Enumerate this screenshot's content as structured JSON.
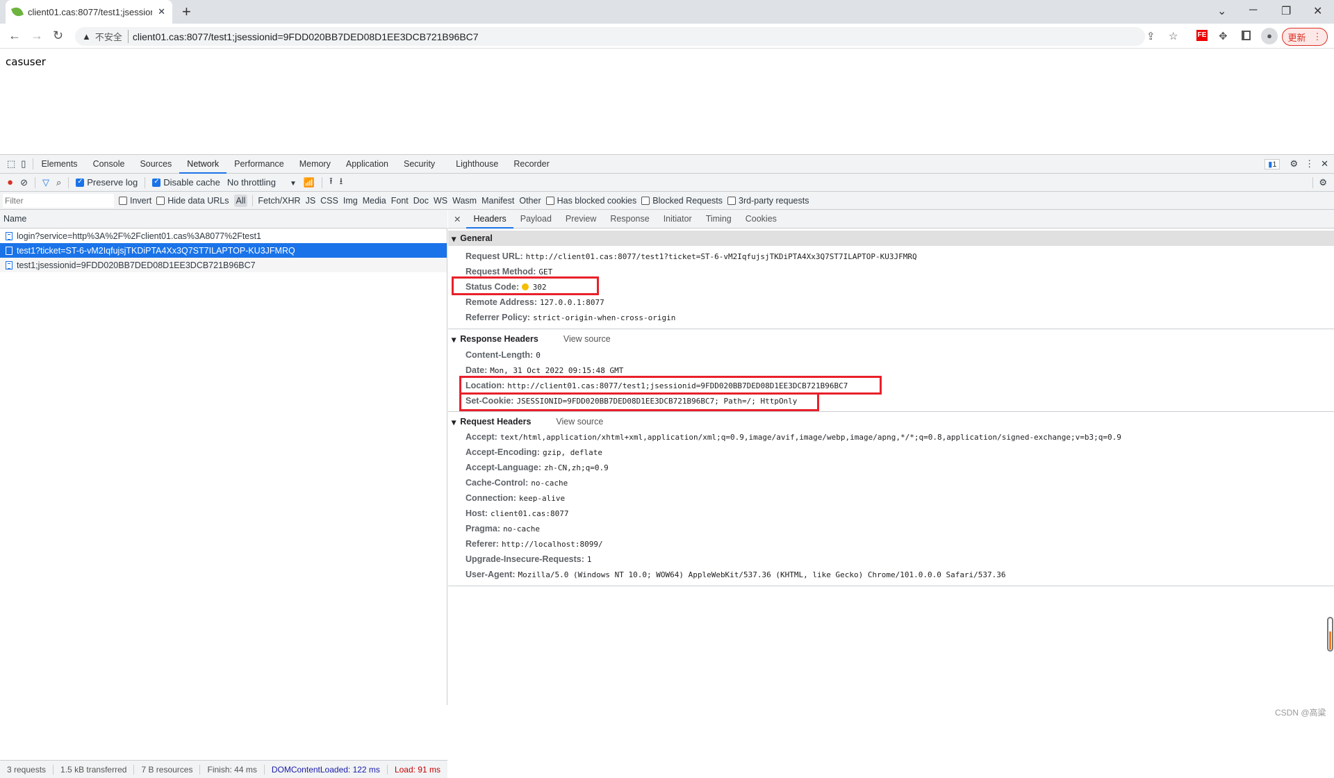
{
  "browser": {
    "tab_title": "client01.cas:8077/test1;jsession",
    "security_label": "不安全",
    "url": "client01.cas:8077/test1;jsessionid=9FDD020BB7DED08D1EE3DCB721B96BC7",
    "update_label": "更新",
    "extension_label": "FE"
  },
  "page": {
    "text": "casuser"
  },
  "devtools": {
    "tabs": [
      "Elements",
      "Console",
      "Sources",
      "Network",
      "Performance",
      "Memory",
      "Application",
      "Security",
      "Lighthouse",
      "Recorder"
    ],
    "active_tab": "Network",
    "issues_count": "1",
    "toolbar": {
      "preserve_log": "Preserve log",
      "disable_cache": "Disable cache",
      "throttling": "No throttling"
    },
    "filter": {
      "placeholder": "Filter",
      "invert": "Invert",
      "hide_data_urls": "Hide data URLs",
      "types": [
        "All",
        "Fetch/XHR",
        "JS",
        "CSS",
        "Img",
        "Media",
        "Font",
        "Doc",
        "WS",
        "Wasm",
        "Manifest",
        "Other"
      ],
      "has_blocked_cookies": "Has blocked cookies",
      "blocked_requests": "Blocked Requests",
      "third_party": "3rd-party requests"
    },
    "requests": {
      "header": "Name",
      "items": [
        "login?service=http%3A%2F%2Fclient01.cas%3A8077%2Ftest1",
        "test1?ticket=ST-6-vM2IqfujsjTKDiPTA4Xx3Q7ST7ILAPTOP-KU3JFMRQ",
        "test1;jsessionid=9FDD020BB7DED08D1EE3DCB721B96BC7"
      ],
      "selected_index": 1
    },
    "status": {
      "requests": "3 requests",
      "transferred": "1.5 kB transferred",
      "resources": "7 B resources",
      "finish": "Finish: 44 ms",
      "dcl": "DOMContentLoaded: 122 ms",
      "load": "Load: 91 ms"
    },
    "detail_tabs": [
      "Headers",
      "Payload",
      "Preview",
      "Response",
      "Initiator",
      "Timing",
      "Cookies"
    ],
    "general": {
      "title": "General",
      "rows": [
        {
          "k": "Request URL:",
          "v": "http://client01.cas:8077/test1?ticket=ST-6-vM2IqfujsjTKDiPTA4Xx3Q7ST7ILAPTOP-KU3JFMRQ"
        },
        {
          "k": "Request Method:",
          "v": "GET"
        },
        {
          "k": "Status Code:",
          "v": "302"
        },
        {
          "k": "Remote Address:",
          "v": "127.0.0.1:8077"
        },
        {
          "k": "Referrer Policy:",
          "v": "strict-origin-when-cross-origin"
        }
      ]
    },
    "response_headers": {
      "title": "Response Headers",
      "view_source": "View source",
      "rows": [
        {
          "k": "Content-Length:",
          "v": "0"
        },
        {
          "k": "Date:",
          "v": "Mon, 31 Oct 2022 09:15:48 GMT"
        },
        {
          "k": "Location:",
          "v": "http://client01.cas:8077/test1;jsessionid=9FDD020BB7DED08D1EE3DCB721B96BC7"
        },
        {
          "k": "Set-Cookie:",
          "v": "JSESSIONID=9FDD020BB7DED08D1EE3DCB721B96BC7; Path=/; HttpOnly"
        }
      ]
    },
    "request_headers": {
      "title": "Request Headers",
      "view_source": "View source",
      "rows": [
        {
          "k": "Accept:",
          "v": "text/html,application/xhtml+xml,application/xml;q=0.9,image/avif,image/webp,image/apng,*/*;q=0.8,application/signed-exchange;v=b3;q=0.9"
        },
        {
          "k": "Accept-Encoding:",
          "v": "gzip, deflate"
        },
        {
          "k": "Accept-Language:",
          "v": "zh-CN,zh;q=0.9"
        },
        {
          "k": "Cache-Control:",
          "v": "no-cache"
        },
        {
          "k": "Connection:",
          "v": "keep-alive"
        },
        {
          "k": "Host:",
          "v": "client01.cas:8077"
        },
        {
          "k": "Pragma:",
          "v": "no-cache"
        },
        {
          "k": "Referer:",
          "v": "http://localhost:8099/"
        },
        {
          "k": "Upgrade-Insecure-Requests:",
          "v": "1"
        },
        {
          "k": "User-Agent:",
          "v": "Mozilla/5.0 (Windows NT 10.0; WOW64) AppleWebKit/537.36 (KHTML, like Gecko) Chrome/101.0.0.0 Safari/537.36"
        }
      ]
    }
  },
  "watermark": "CSDN @高粱",
  "colors": {
    "accent": "#1a73e8",
    "highlight_box": "#e8202a",
    "status_dot": "#f5bd00",
    "dcl": "#1a1aa6",
    "load": "#c80000"
  }
}
